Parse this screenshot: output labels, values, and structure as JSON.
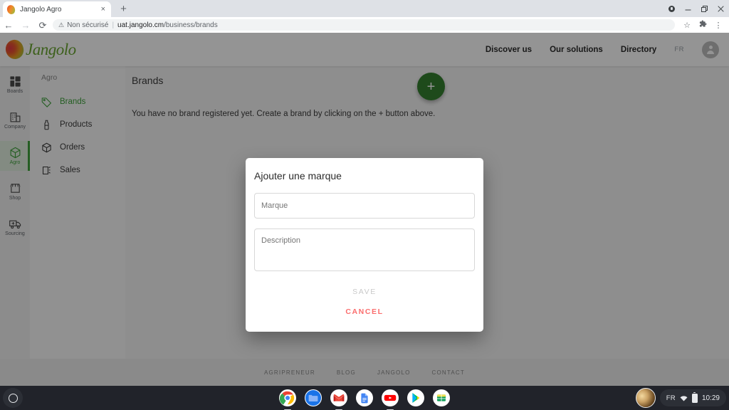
{
  "browser": {
    "tab": {
      "title": "Jangolo Agro",
      "favicon": "mango-favicon",
      "close": "×"
    },
    "new_tab": "+",
    "window_controls": {
      "profile": "profile-badge",
      "minimize": "—",
      "maximize": "❐",
      "close": "✕"
    },
    "toolbar": {
      "back": "←",
      "forward": "→",
      "reload": "⟳",
      "security_warning_icon": "⚠",
      "security_label": "Non sécurisé",
      "separator": "|",
      "url_host": "uat.jangolo.cm",
      "url_path": "/business/brands",
      "bookmark": "☆",
      "extensions": "❖",
      "menu": "⋮"
    }
  },
  "site_header": {
    "logo_word": "Jangolo",
    "nav": [
      {
        "label": "Discover us"
      },
      {
        "label": "Our solutions"
      },
      {
        "label": "Directory"
      }
    ],
    "language": "FR",
    "account": "account-avatar"
  },
  "rail": {
    "items": [
      {
        "label": "Boards",
        "icon": "dashboard-icon",
        "active": false
      },
      {
        "label": "Company",
        "icon": "building-icon",
        "active": false
      },
      {
        "label": "Agro",
        "icon": "box-icon",
        "active": true
      },
      {
        "label": "Shop",
        "icon": "storefront-icon",
        "active": false
      },
      {
        "label": "Sourcing",
        "icon": "truck-icon",
        "active": false
      }
    ]
  },
  "submenu": {
    "title": "Agro",
    "items": [
      {
        "label": "Brands",
        "icon": "tag-icon",
        "active": true
      },
      {
        "label": "Products",
        "icon": "bottle-icon",
        "active": false
      },
      {
        "label": "Orders",
        "icon": "package-icon",
        "active": false
      },
      {
        "label": "Sales",
        "icon": "sales-icon",
        "active": false
      }
    ]
  },
  "content": {
    "page_title": "Brands",
    "add_button": "+",
    "empty_message": "You have no brand registered yet. Create a brand by clicking on the + button above."
  },
  "footer": {
    "links": [
      "AGRIPRENEUR",
      "BLOG",
      "JANGOLO",
      "CONTACT"
    ]
  },
  "modal": {
    "title": "Ajouter une marque",
    "name_field": {
      "value": "",
      "placeholder": "Marque"
    },
    "description_field": {
      "value": "",
      "placeholder": "Description"
    },
    "save_label": "SAVE",
    "cancel_label": "CANCEL"
  },
  "shelf": {
    "launcher": "launcher-icon",
    "apps": [
      {
        "name": "chrome-app",
        "running": true
      },
      {
        "name": "files-app",
        "running": false
      },
      {
        "name": "gmail-app",
        "running": true
      },
      {
        "name": "docs-app",
        "running": false
      },
      {
        "name": "youtube-app",
        "running": true
      },
      {
        "name": "play-store-app",
        "running": false
      },
      {
        "name": "sheets-app",
        "running": false
      }
    ],
    "tray": {
      "language": "FR",
      "wifi": "wifi-icon",
      "battery": "battery-icon",
      "clock": "10:29"
    }
  },
  "colors": {
    "brand_green": "#3fa23c",
    "fab_green": "#35802f",
    "cancel_red": "#fb6d6d",
    "disabled_grey": "#c9c9c9",
    "shelf_dark": "#21232a"
  }
}
